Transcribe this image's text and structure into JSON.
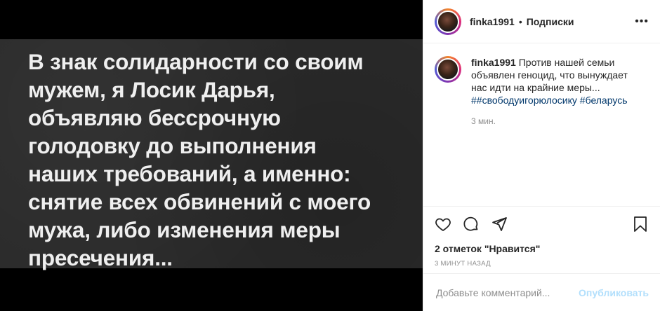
{
  "post": {
    "image_text": "В знак солидарности со своим\nмужем, я Лосик Дарья,\nобъявляю бессрочную\nголодовку до выполнения\nнаших требований, а именно:\nснятие всех обвинений с моего\nмужа, либо изменения меры\nпресечения..."
  },
  "header": {
    "username": "finka1991",
    "separator": "•",
    "follow_label": "Подписки",
    "more_label": "•••"
  },
  "caption": {
    "username": "finka1991",
    "text": "Против нашей семьи объявлен геноцид, что вынуждает нас идти на крайние меры...",
    "hashtags": "##свободуигорюлосику #беларусь",
    "time": "3 мин."
  },
  "actions": {
    "like_icon": "heart-icon",
    "comment_icon": "comment-icon",
    "share_icon": "share-icon",
    "save_icon": "bookmark-icon"
  },
  "likes_text": "2 отметок \"Нравится\"",
  "posted_time": "3 минут назад",
  "comment_box": {
    "placeholder": "Добавьте комментарий...",
    "post_label": "Опубликовать"
  }
}
